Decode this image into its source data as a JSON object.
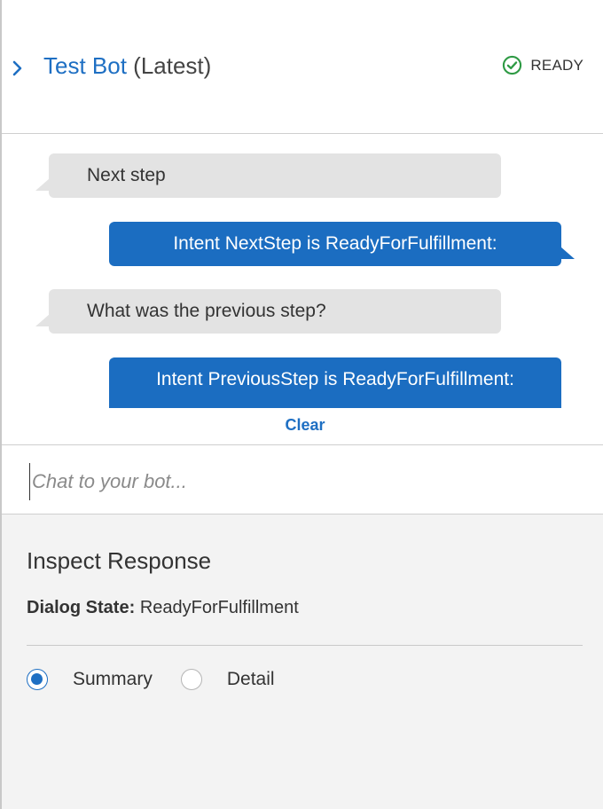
{
  "header": {
    "title_name": "Test Bot",
    "title_version": "(Latest)",
    "status_label": "READY",
    "status_color": "#2e9a44"
  },
  "conversation": {
    "messages": [
      {
        "from": "user",
        "text": "Next step"
      },
      {
        "from": "bot",
        "text": "Intent NextStep is ReadyForFulfillment:"
      },
      {
        "from": "user",
        "text": "What was the previous step?"
      },
      {
        "from": "bot",
        "text": "Intent PreviousStep is ReadyForFulfillment:"
      }
    ],
    "clear_label": "Clear"
  },
  "chat_input": {
    "placeholder": "Chat to your bot...",
    "value": ""
  },
  "inspect": {
    "title": "Inspect Response",
    "dialog_state_label": "Dialog State:",
    "dialog_state_value": "ReadyForFulfillment",
    "view_options": [
      {
        "label": "Summary",
        "selected": true
      },
      {
        "label": "Detail",
        "selected": false
      }
    ]
  },
  "colors": {
    "accent": "#1e6fc3",
    "bot_bubble": "#1b6dc1",
    "user_bubble": "#e3e3e3",
    "inspect_bg": "#f3f3f3"
  },
  "icons": [
    "chevron-right-icon",
    "check-circle-icon"
  ]
}
